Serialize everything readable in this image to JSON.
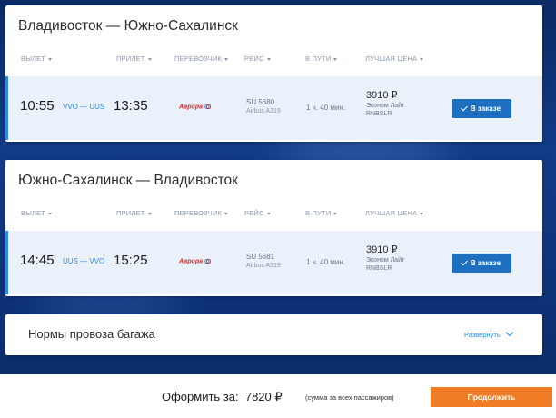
{
  "colors": {
    "accent": "#2e8ae6",
    "button_blue": "#1f6fc1",
    "button_orange": "#f07d25",
    "row_highlight": "#eaf1fa",
    "carrier_red": "#d72d2d"
  },
  "columns": {
    "depart": "ВЫЛЕТ",
    "arrive": "ПРИЛЕТ",
    "carrier": "ПЕРЕВОЗЧИК",
    "flight": "РЕЙС",
    "duration": "В ПУТИ",
    "best_price": "ЛУЧШАЯ ЦЕНА"
  },
  "outbound": {
    "title": "Владивосток — Южно-Сахалинск",
    "depart_time": "10:55",
    "route_codes": "VVO — UUS",
    "arrive_time": "13:35",
    "carrier": "Аврора",
    "flight_number": "SU 5680",
    "aircraft": "Airbus A319",
    "duration": "1 ч. 40 мин.",
    "price": "3910 ₽",
    "fare": "Эконом Лайт",
    "fare_code": "RNBSLR",
    "order_label": "В заказе"
  },
  "return": {
    "title": "Южно-Сахалинск — Владивосток",
    "depart_time": "14:45",
    "route_codes": "UUS — VVO",
    "arrive_time": "15:25",
    "carrier": "Аврора",
    "flight_number": "SU 5681",
    "aircraft": "Airbus A319",
    "duration": "1 ч. 40 мин.",
    "price": "3910 ₽",
    "fare": "Эконом Лайт",
    "fare_code": "RNBSLR",
    "order_label": "В заказе"
  },
  "baggage": {
    "title": "Нормы провоза багажа",
    "expand_label": "Развернуть"
  },
  "footer": {
    "total_label": "Оформить за:",
    "total_amount": "7820 ₽",
    "total_note": "(сумма за всех пассажиров)",
    "continue_label": "Продолжить"
  }
}
